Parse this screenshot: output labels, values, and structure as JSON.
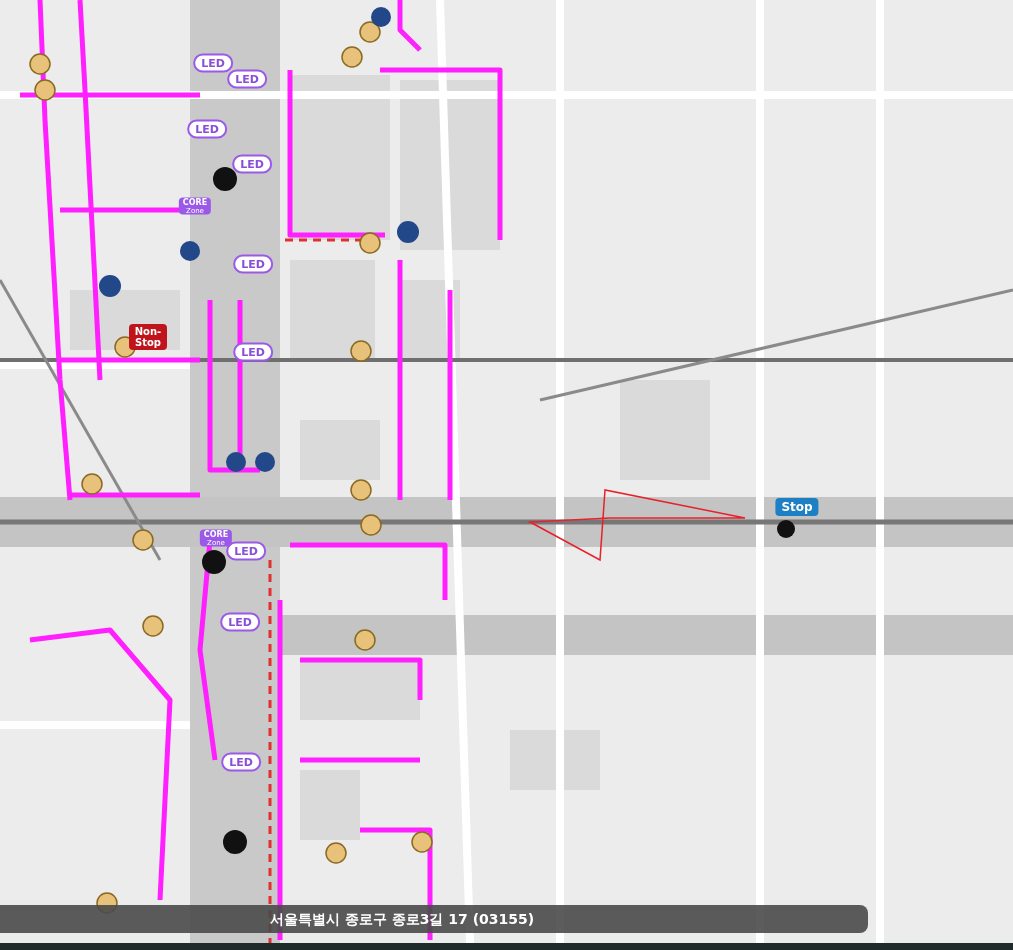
{
  "map": {
    "markers": [
      {
        "kind": "led",
        "label": "LED"
      },
      {
        "kind": "led",
        "label": "LED"
      },
      {
        "kind": "led",
        "label": "LED"
      },
      {
        "kind": "led",
        "label": "LED"
      },
      {
        "kind": "led",
        "label": "LED"
      },
      {
        "kind": "led",
        "label": "LED"
      },
      {
        "kind": "led",
        "label": "LED"
      },
      {
        "kind": "led",
        "label": "LED"
      },
      {
        "kind": "led",
        "label": "LED"
      },
      {
        "kind": "zone",
        "label": "CORE",
        "sublabel": "Zone"
      },
      {
        "kind": "zone",
        "label": "CORE",
        "sublabel": "Zone"
      },
      {
        "kind": "nonstop",
        "label": "Non-Stop"
      },
      {
        "kind": "stop",
        "label": "Stop"
      }
    ]
  },
  "address_bar": {
    "text": "서울특별시 종로구 종로3길 17 (03155)"
  }
}
